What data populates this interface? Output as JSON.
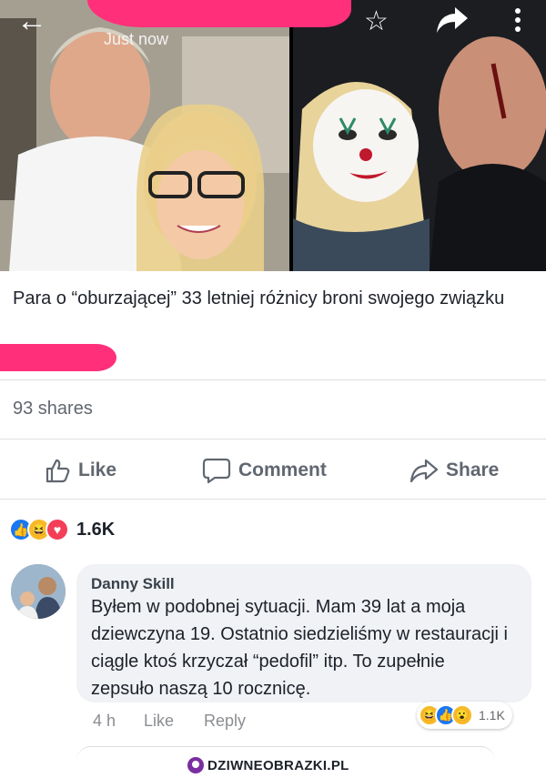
{
  "header": {
    "timestamp": "Just now",
    "back_glyph": "←",
    "star_glyph": "☆",
    "share_glyph": "➦"
  },
  "post": {
    "caption": "Para o “oburzającej” 33 letniej różnicy broni swojego związku",
    "shares": "93 shares"
  },
  "actions": {
    "like": "Like",
    "comment": "Comment",
    "share": "Share"
  },
  "reactions": {
    "count": "1.6K",
    "icons": [
      "like-icon",
      "haha-icon",
      "love-icon"
    ],
    "like_glyph": "👍",
    "haha_glyph": "😆",
    "love_glyph": "♥"
  },
  "comment": {
    "author": "Danny Skill",
    "text": "Byłem w podobnej sytuacji. Mam 39 lat a moja dziewczyna 19. Ostatnio siedzieliśmy w restauracji i ciągle ktoś krzyczał “pedofil” itp. To zupełnie zepsuło naszą 10 rocznicę.",
    "time": "4 h",
    "like_label": "Like",
    "reply_label": "Reply",
    "reaction_count": "1.1K",
    "reaction_icons": [
      "haha-icon",
      "like-icon",
      "wow-icon"
    ],
    "wow_glyph": "😮"
  },
  "watermark": {
    "text": "DZIWNEOBRAZKI.PL"
  },
  "colors": {
    "accent": "#1877f2",
    "redaction": "#ff2f7a",
    "bubble": "#f0f2f5",
    "muted_text": "#616770"
  }
}
